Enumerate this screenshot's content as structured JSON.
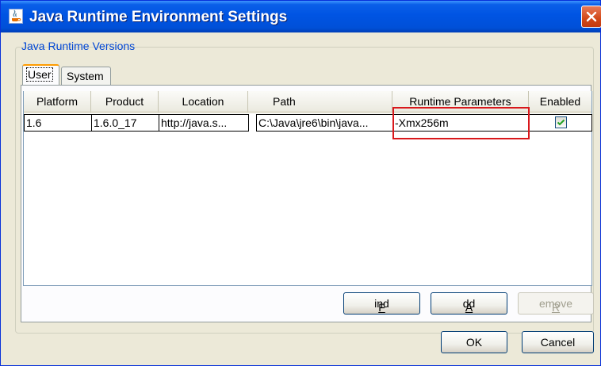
{
  "window": {
    "title": "Java Runtime Environment Settings"
  },
  "group": {
    "label": "Java Runtime Versions"
  },
  "tabs": [
    {
      "label": "User",
      "active": true
    },
    {
      "label": "System",
      "active": false
    }
  ],
  "table": {
    "columns": [
      "Platform",
      "Product",
      "Location",
      "Path",
      "Runtime Parameters",
      "Enabled"
    ],
    "rows": [
      {
        "platform": "1.6",
        "product": "1.6.0_17",
        "location": "http://java.s...",
        "path": "C:\\Java\\jre6\\bin\\java...",
        "runtime_parameters": "-Xmx256m",
        "enabled": true
      }
    ]
  },
  "buttons": {
    "find": {
      "mnemonic": "F",
      "rest": "ind"
    },
    "add": {
      "mnemonic": "A",
      "rest": "dd"
    },
    "remove": {
      "mnemonic": "R",
      "rest": "emove",
      "disabled": true
    },
    "ok": "OK",
    "cancel": "Cancel"
  },
  "colors": {
    "title_bar": "#0054e3",
    "highlight_box": "#d9181c",
    "group_label": "#0046d5"
  }
}
